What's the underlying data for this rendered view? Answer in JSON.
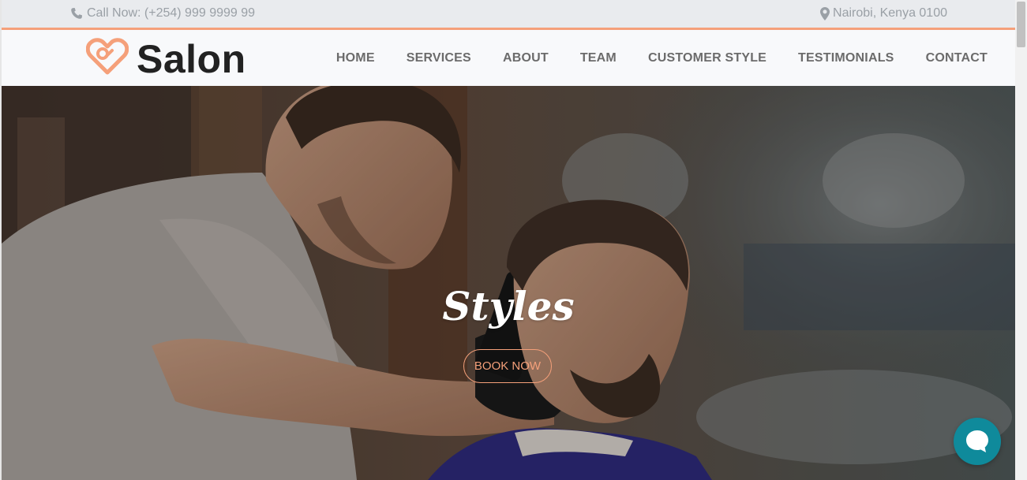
{
  "topbar": {
    "call_text": "Call Now: (+254) 999 9999 99",
    "location_text": "Nairobi, Kenya 0100",
    "icons": {
      "phone": "phone-icon",
      "location": "map-marker-icon"
    }
  },
  "header": {
    "logo_text": "Salon",
    "logo_icon": "heart-logo-icon",
    "nav": [
      "HOME",
      "SERVICES",
      "ABOUT",
      "TEAM",
      "CUSTOMER STYLE",
      "TESTIMONIALS",
      "CONTACT"
    ]
  },
  "hero": {
    "title": "Styles",
    "button_label": "BOOK NOW"
  },
  "chat": {
    "icon": "chat-bubble-icon"
  },
  "colors": {
    "accent": "#f5a07a",
    "topbar_bg": "#e9ebee",
    "header_bg": "#f8f9fb",
    "nav_text": "#6b6b6b",
    "chat_bg": "#0f8a9b"
  }
}
